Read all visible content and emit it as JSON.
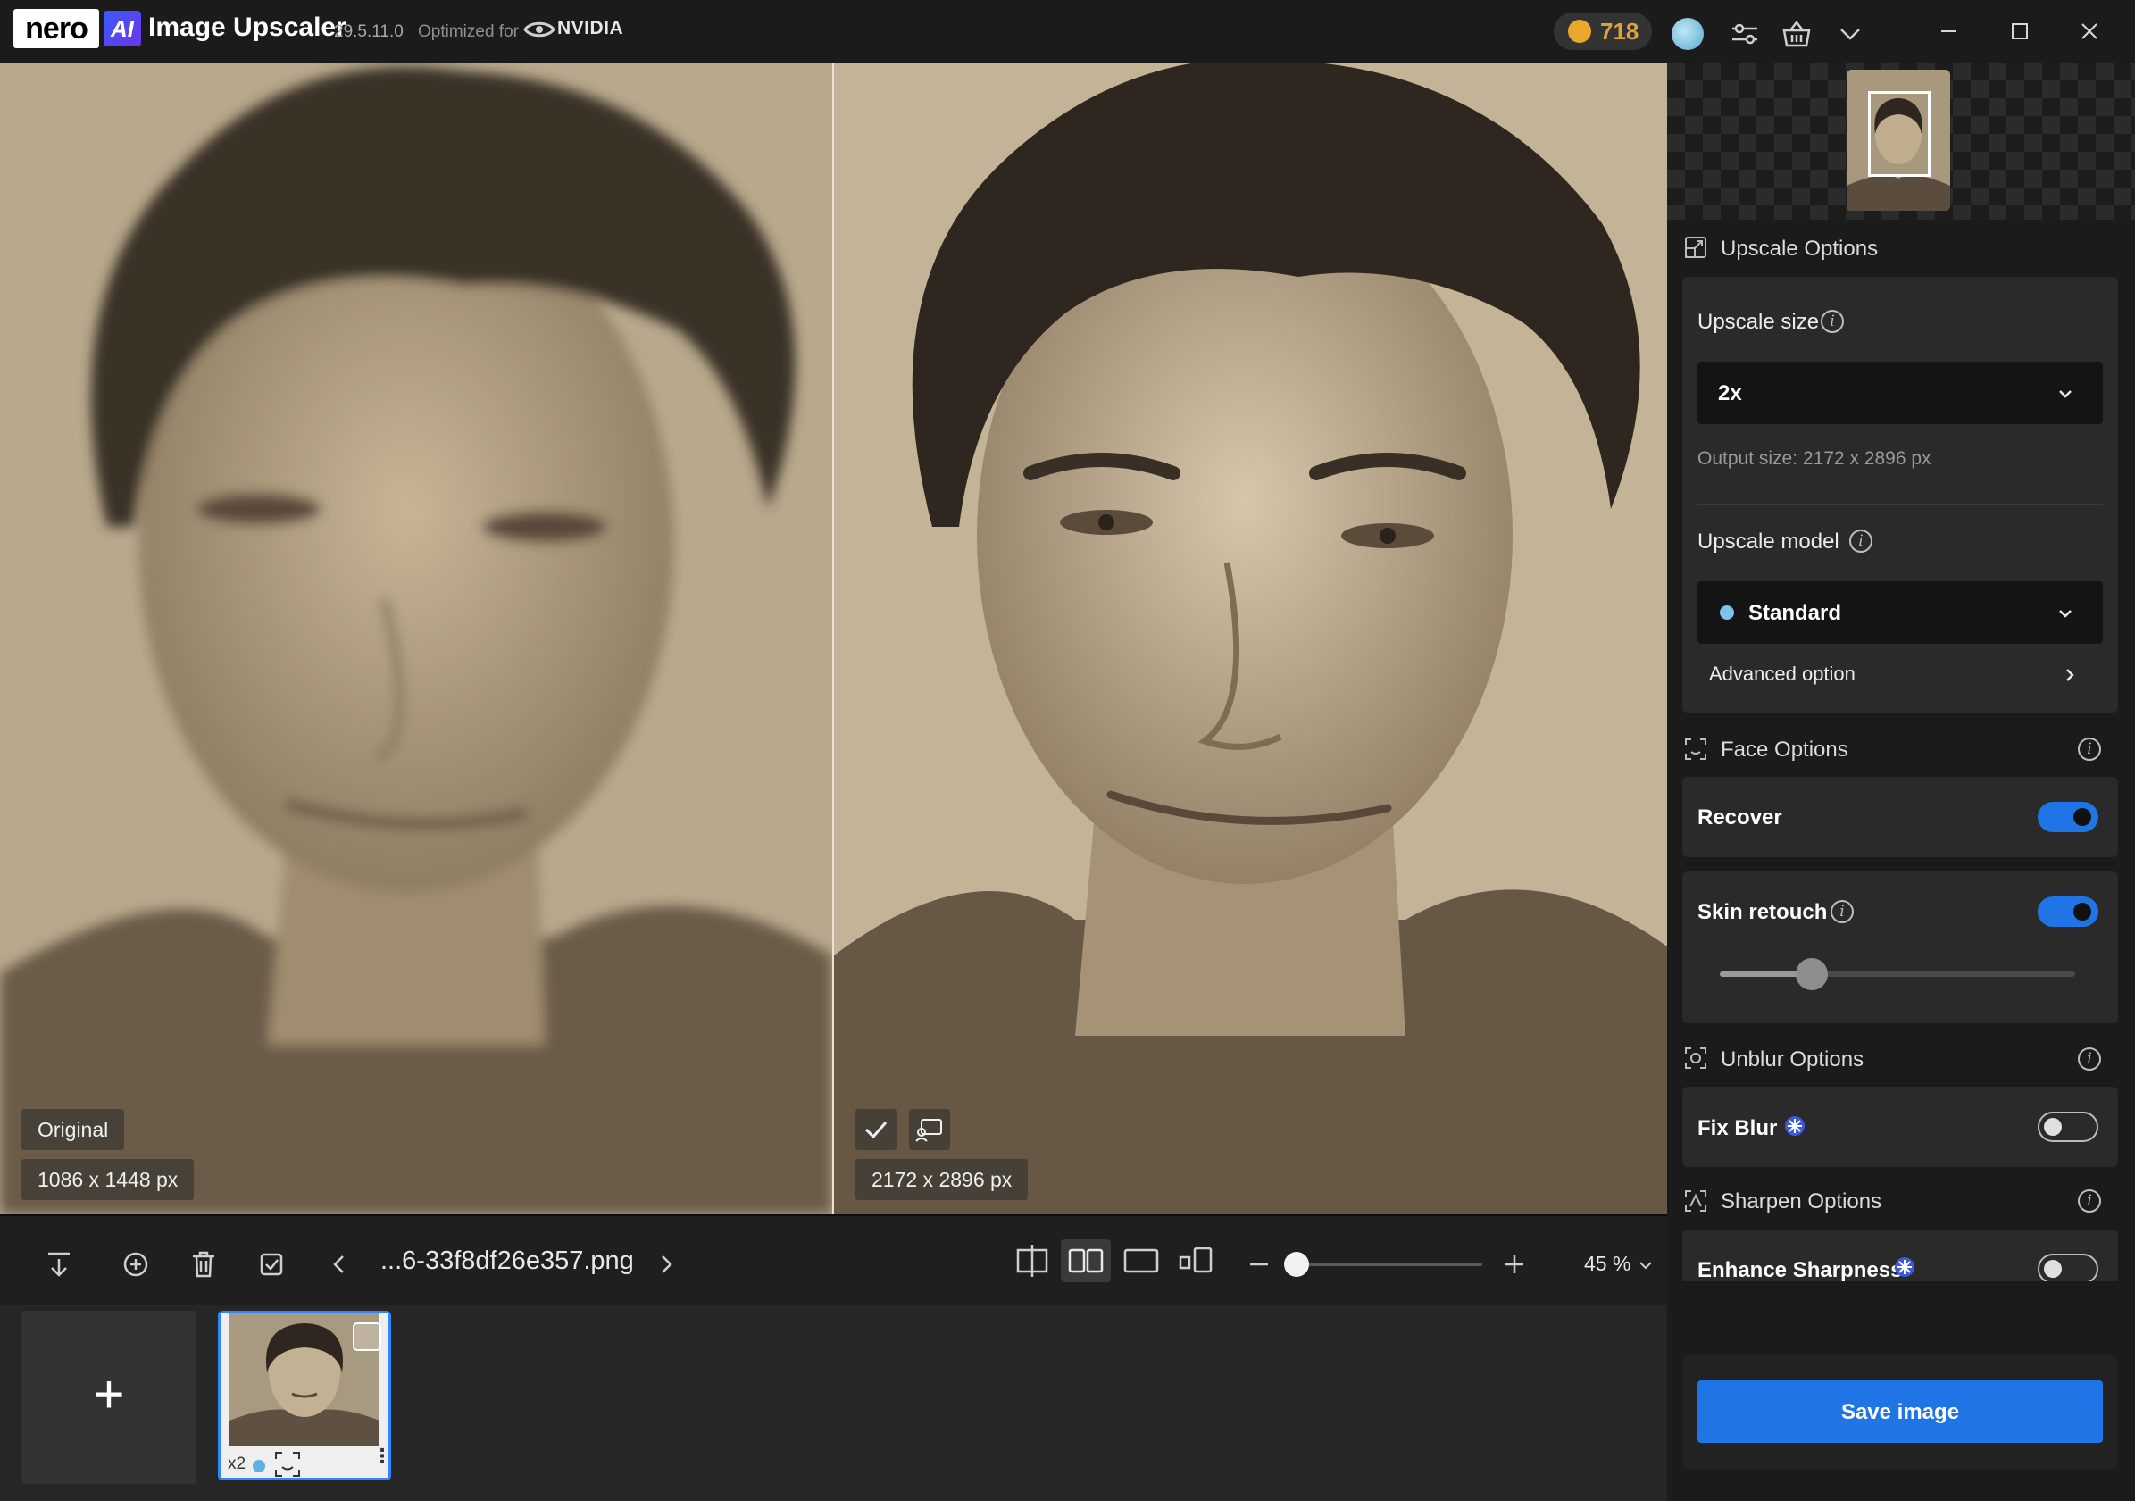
{
  "app": {
    "brand": "nero",
    "ai_badge": "AI",
    "name": "Image Upscaler",
    "version": "29.5.11.0",
    "optimized_for": "Optimized for",
    "partner": "NVIDIA",
    "credits": "718"
  },
  "preview": {
    "left_label": "Original",
    "left_size": "1086 x 1448 px",
    "right_size": "2172 x 2896 px"
  },
  "toolbar": {
    "filename": "...6-33f8df26e357.png",
    "zoom": "45 %",
    "zoom_level": 0.05
  },
  "filmstrip": {
    "add_label": "+",
    "items": [
      {
        "scale": "x2",
        "selected": true
      }
    ]
  },
  "panel": {
    "upscale": {
      "title": "Upscale Options",
      "size_label": "Upscale size",
      "size_value": "2x",
      "output_size": "Output size: 2172 x 2896 px",
      "model_label": "Upscale model",
      "model_value": "Standard",
      "advanced_label": "Advanced option"
    },
    "face": {
      "title": "Face Options",
      "recover_label": "Recover",
      "recover_on": true,
      "skin_label": "Skin retouch",
      "skin_on": true,
      "skin_level": 0.26
    },
    "unblur": {
      "title": "Unblur Options",
      "fix_blur_label": "Fix Blur",
      "fix_blur_on": false
    },
    "sharpen": {
      "title": "Sharpen Options",
      "enhance_label": "Enhance Sharpness",
      "enhance_on": false
    },
    "save_label": "Save image"
  },
  "colors": {
    "accent": "#1f74e6",
    "panel_bg": "#1b1b1b",
    "card_bg": "#2a2a2a",
    "credit_gold": "#d9a23a"
  },
  "icons": [
    "minimize-icon",
    "maximize-icon",
    "close-icon",
    "sliders-icon",
    "basket-icon",
    "chevron-down-icon",
    "download-icon",
    "add-circle-icon",
    "trash-icon",
    "check-square-icon",
    "chevron-left-icon",
    "chevron-right-icon",
    "compare-split-icon",
    "side-by-side-icon",
    "single-view-icon",
    "thumbnail-view-icon",
    "minus-icon",
    "plus-icon",
    "info-icon",
    "face-scan-icon",
    "unblur-icon",
    "sharpen-icon",
    "upscale-icon",
    "ai-sparkle-icon"
  ]
}
